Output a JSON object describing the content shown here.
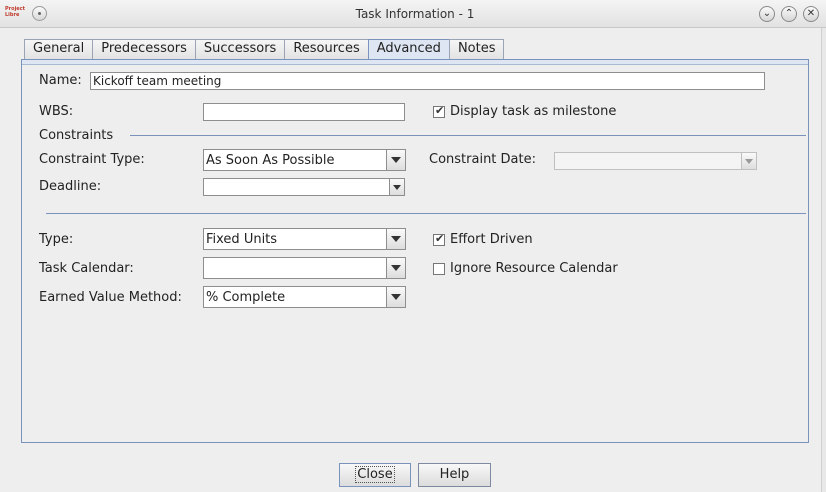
{
  "window": {
    "title": "Task Information - 1",
    "app_logo_text": "Project Libre",
    "icons": [
      "menu-icon",
      "minimize-icon",
      "maximize-icon",
      "close-icon"
    ],
    "controls": {
      "minimize": "⌄",
      "maximize": "⌃",
      "close": "✕"
    }
  },
  "tabs": [
    {
      "label": "General",
      "active": false
    },
    {
      "label": "Predecessors",
      "active": false
    },
    {
      "label": "Successors",
      "active": false
    },
    {
      "label": "Resources",
      "active": false
    },
    {
      "label": "Advanced",
      "active": true
    },
    {
      "label": "Notes",
      "active": false
    }
  ],
  "form": {
    "name_label": "Name:",
    "name_value": "Kickoff team meeting",
    "wbs_label": "WBS:",
    "wbs_value": "",
    "milestone_label": "Display task as milestone",
    "milestone_checked": true,
    "constraints_heading": "Constraints",
    "constraint_type_label": "Constraint Type:",
    "constraint_type_value": "As Soon As Possible",
    "constraint_date_label": "Constraint Date:",
    "constraint_date_value": "",
    "deadline_label": "Deadline:",
    "deadline_value": "",
    "type_label": "Type:",
    "type_value": "Fixed Units",
    "effort_driven_label": "Effort Driven",
    "effort_driven_checked": true,
    "task_calendar_label": "Task Calendar:",
    "task_calendar_value": "",
    "ignore_calendar_label": "Ignore Resource Calendar",
    "ignore_calendar_checked": false,
    "earned_value_label": "Earned Value Method:",
    "earned_value_value": "% Complete"
  },
  "buttons": {
    "close": "Close",
    "help": "Help"
  },
  "colors": {
    "accent_border": "#7a93bd",
    "active_tab": "#dde6f2",
    "background": "#eeeeee"
  }
}
